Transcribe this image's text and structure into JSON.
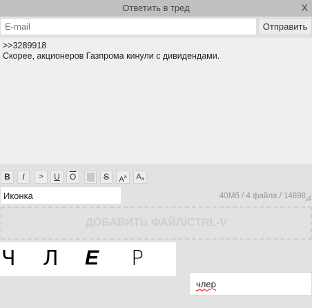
{
  "window": {
    "title": "Ответить в тред",
    "close_label": "X"
  },
  "form": {
    "email_placeholder": "E-mail",
    "send_label": "Отправить",
    "message_text": ">>3289918\nСкорее, акционеров Газпрома кинули с дивидендами.",
    "counter": "40Мб / 4 файла / 14898"
  },
  "format_buttons": {
    "bold": "B",
    "italic": "I",
    "greentext": ">",
    "underline": "U",
    "overline": "O",
    "strike": "S",
    "sup_base": "A",
    "sup_small": "a",
    "sub_base": "A",
    "sub_small": "a"
  },
  "icon_select": {
    "value": "Иконка"
  },
  "dropzone": {
    "label": "ДОБАВИТЬ ФАЙЛ/CTRL-V"
  },
  "captcha": {
    "chars": [
      "Ч",
      "Л",
      "Е",
      "Р"
    ],
    "answer": "члер"
  },
  "colors": {
    "background": "#e2e2e2",
    "titlebar": "#c0c0c0",
    "dropzone_text": "#cfcfcf"
  }
}
